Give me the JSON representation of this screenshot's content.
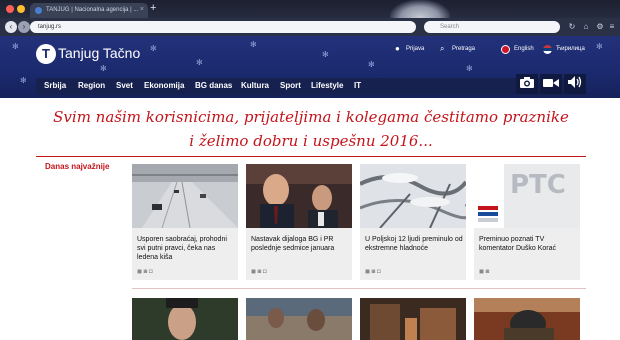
{
  "browser": {
    "tab_title": "TANJUG | Nacionalna agencija | ...",
    "tab_close": "×",
    "new_tab": "+",
    "url": "tanjug.rs",
    "search_placeholder": "Search",
    "back": "‹",
    "forward": "›",
    "reload": "↻",
    "home": "⌂",
    "menu": "≡"
  },
  "site": {
    "logo_letter": "T",
    "logo_text": "Tanjug Tačno",
    "login_label": "Prijava",
    "search_label": "Pretraga",
    "english_label": "English",
    "cyrillic_label": "Ћирилица",
    "menu": [
      "Srbija",
      "Region",
      "Svet",
      "Ekonomija",
      "BG danas",
      "Kultura",
      "Sport",
      "Lifestyle",
      "IT"
    ],
    "media_icons": [
      "camera-icon",
      "video-icon",
      "audio-icon"
    ]
  },
  "greeting": {
    "line1": "Svim našim korisnicima, prijateljima i kolegama čestitamo praznike",
    "line2": "i želimo dobru i uspešnu 2016..."
  },
  "section_title": "Danas najvažnije",
  "cards": [
    {
      "title": "Usporen saobraćaj, prohodni svi putni pravci, čeka nas ledena kiša"
    },
    {
      "title": "Nastavak dijaloga BG i PR poslednje sedmice januara"
    },
    {
      "title": "U Poljskoj 12 ljudi preminulo od ekstremne hladnoće"
    },
    {
      "title": "Preminuo poznati TV komentator Duško Korać"
    }
  ],
  "rts_logo_text": "РТС",
  "colors": {
    "brand": "#1b2a6e",
    "accent": "#c4141b",
    "card_bg": "#eeeeee"
  }
}
